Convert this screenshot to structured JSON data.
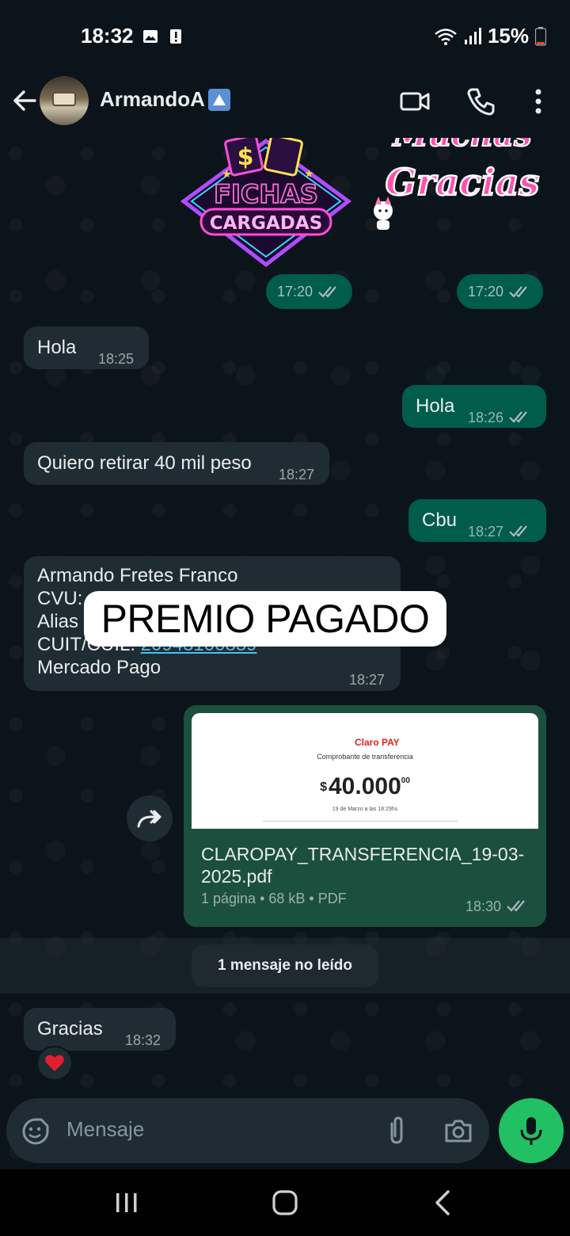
{
  "status": {
    "time": "18:32",
    "battery": "15%"
  },
  "header": {
    "contact_name": "ArmandoA"
  },
  "stickers": {
    "neon_line1": "FICHAS",
    "neon_line2": "CARGADAS",
    "pink_top": "Muchas",
    "pink_bottom": "Gracias",
    "time1": "17:20",
    "time2": "17:20"
  },
  "messages": [
    {
      "dir": "in",
      "text": "Hola",
      "time": "18:25"
    },
    {
      "dir": "out",
      "text": "Hola",
      "time": "18:26"
    },
    {
      "dir": "in",
      "text": "Quiero retirar 40 mil peso",
      "time": "18:27"
    },
    {
      "dir": "out",
      "text": "Cbu",
      "time": "18:27"
    }
  ],
  "account_msg": {
    "line1": "Armando Fretes Franco",
    "line2": "CVU: ",
    "line3": "Alias",
    "line4_label": "CUIT/CUIL: ",
    "line4_link": "20943100839",
    "line5": "Mercado Pago",
    "time": "18:27"
  },
  "overlay": {
    "label": "PREMIO PAGADO"
  },
  "document": {
    "brand": "Claro PAY",
    "subtitle": "Comprobante de transferencia",
    "currency": "$",
    "amount": "40.000",
    "cents": "00",
    "date": "19 de Marzo a las 18:29hs",
    "filename": "CLAROPAY_TRANSFERENCIA_19-03-2025.pdf",
    "meta": "1 página • 68 kB • PDF",
    "time": "18:30"
  },
  "unread": {
    "label": "1 mensaje no leído"
  },
  "last_msg": {
    "text": "Gracias",
    "time": "18:32",
    "reaction": "heart"
  },
  "input": {
    "placeholder": "Mensaje"
  },
  "colors": {
    "incoming": "#202c33",
    "outgoing": "#005c4b",
    "mic": "#21c063",
    "background": "#0b141a"
  }
}
